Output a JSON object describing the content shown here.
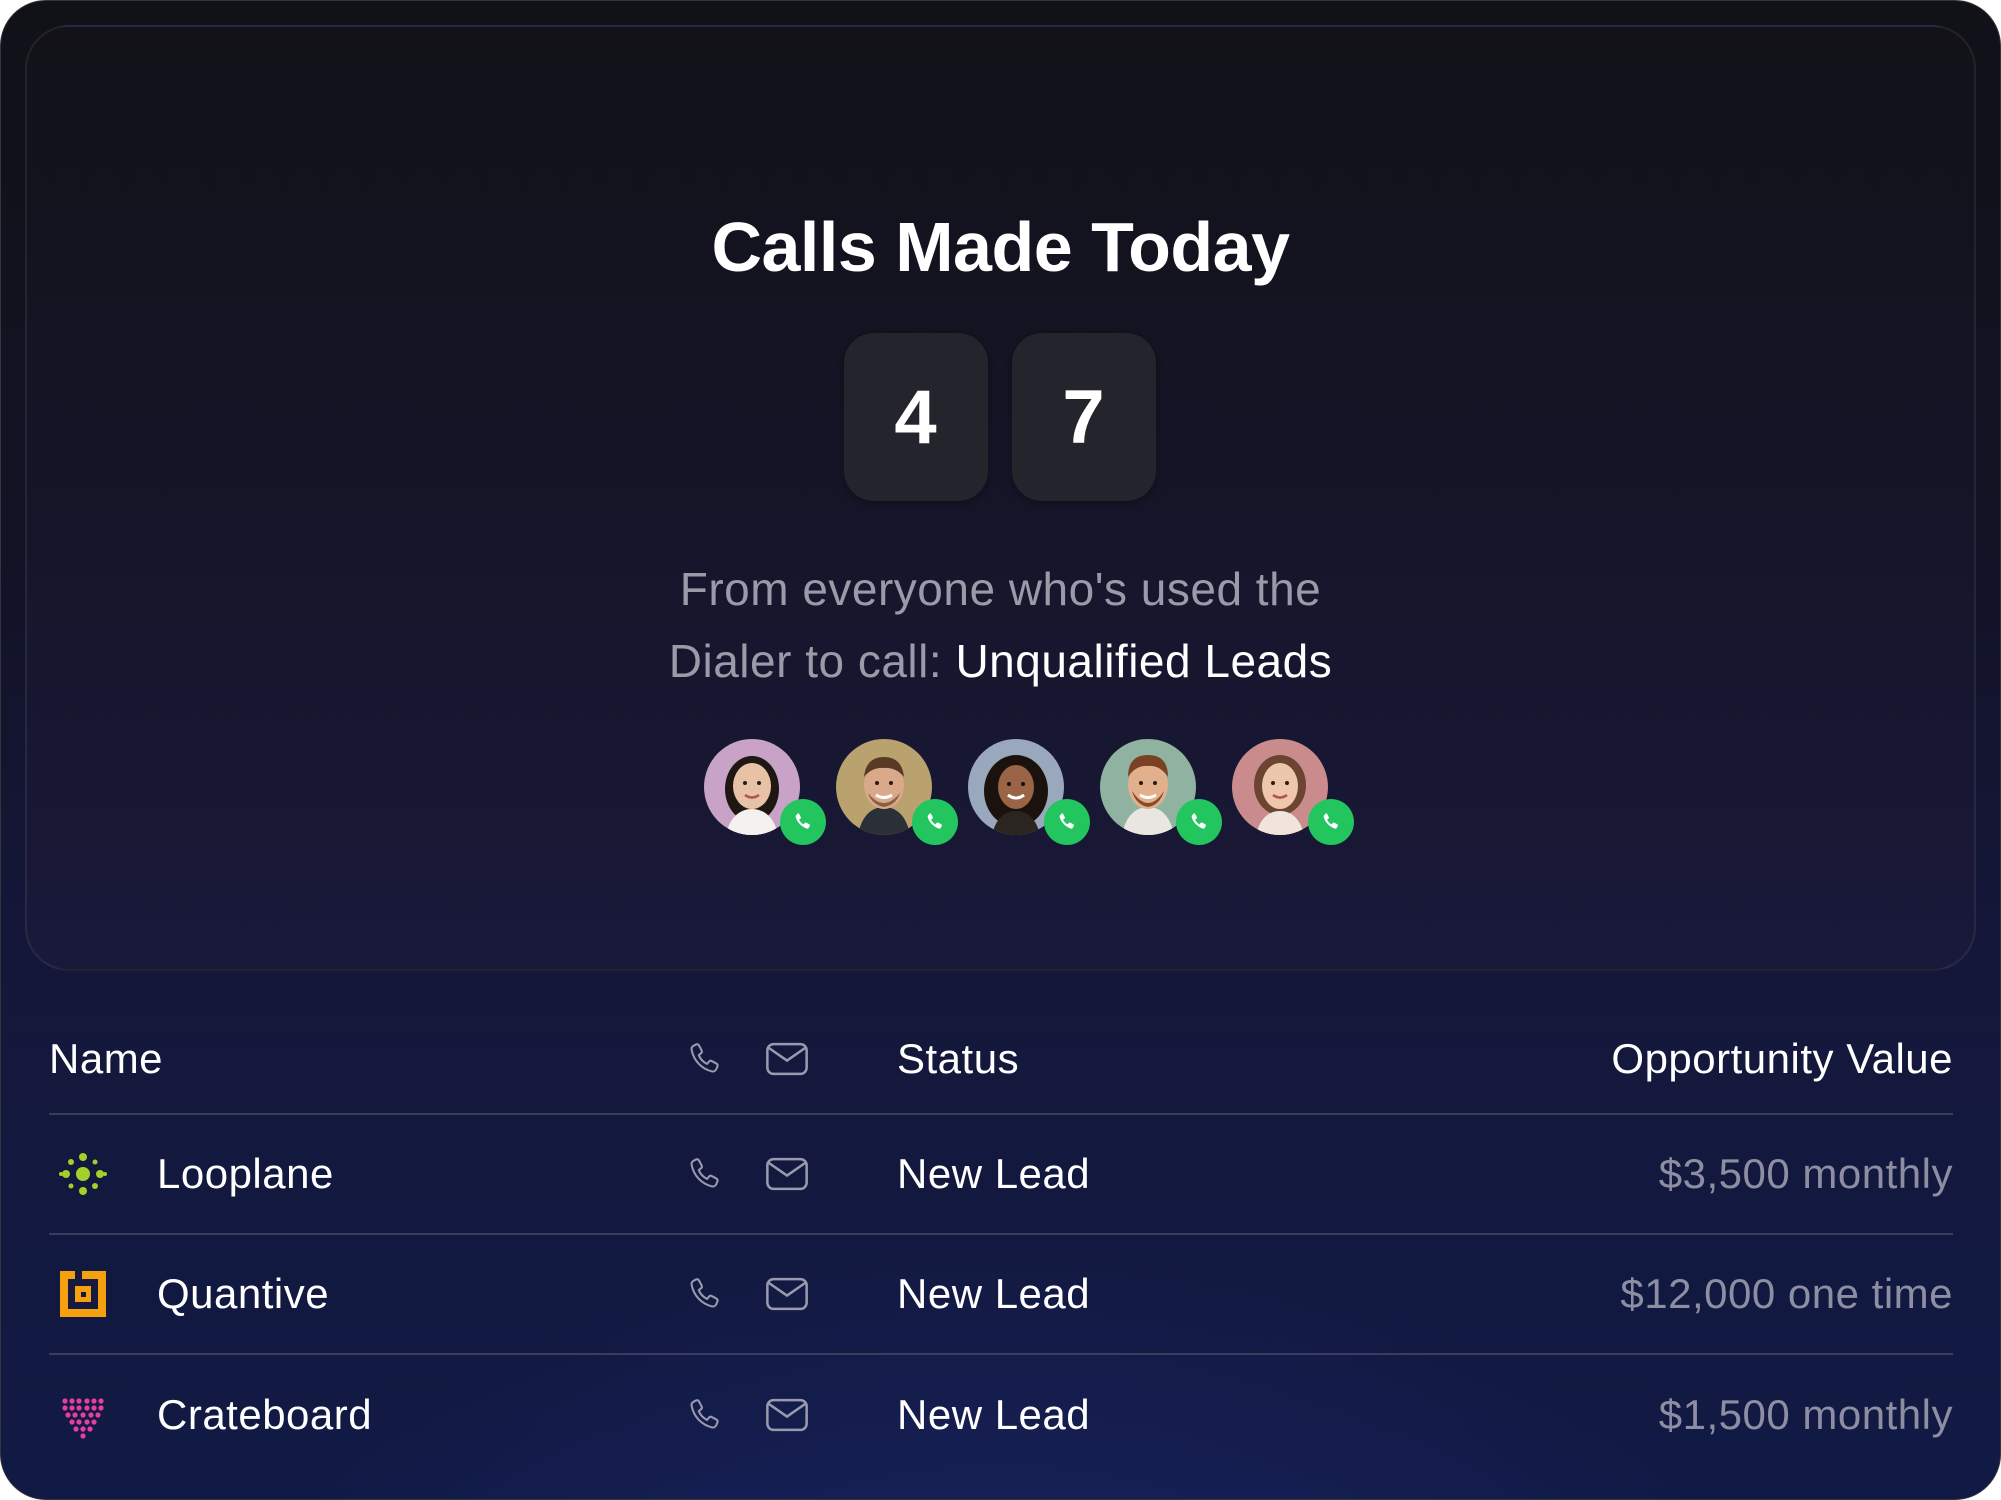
{
  "card": {
    "title": "Calls Made Today",
    "count_digits": [
      "4",
      "7"
    ],
    "subtitle_line1": "From everyone who's used the",
    "subtitle_line2_prefix": "Dialer to call: ",
    "subtitle_line2_highlight": "Unqualified Leads"
  },
  "avatars": [
    {
      "name": "caller-1",
      "bg": "#c9a2c8",
      "skin": "#e8c2a6",
      "hair": "#1f1712"
    },
    {
      "name": "caller-2",
      "bg": "#b9a26e",
      "skin": "#d9a98a",
      "hair": "#5a3a24"
    },
    {
      "name": "caller-3",
      "bg": "#9aa8bd",
      "skin": "#9a6446",
      "hair": "#1b120d"
    },
    {
      "name": "caller-4",
      "bg": "#8fb3a0",
      "skin": "#e3b08e",
      "hair": "#7b4124"
    },
    {
      "name": "caller-5",
      "bg": "#c98b8b",
      "skin": "#edc6ac",
      "hair": "#6b4530"
    }
  ],
  "table": {
    "headers": {
      "name": "Name",
      "status": "Status",
      "value": "Opportunity Value"
    },
    "rows": [
      {
        "name": "Looplane",
        "logo": "looplane-logo",
        "status": "New Lead",
        "value": "$3,500 monthly"
      },
      {
        "name": "Quantive",
        "logo": "quantive-logo",
        "status": "New Lead",
        "value": "$12,000 one time"
      },
      {
        "name": "Crateboard",
        "logo": "crateboard-logo",
        "status": "New Lead",
        "value": "$1,500 monthly"
      }
    ]
  },
  "colors": {
    "accent_green": "#22c55e",
    "looplane": "#a3d12a",
    "quantive": "#f5a00f",
    "crateboard": "#e83e9f"
  }
}
